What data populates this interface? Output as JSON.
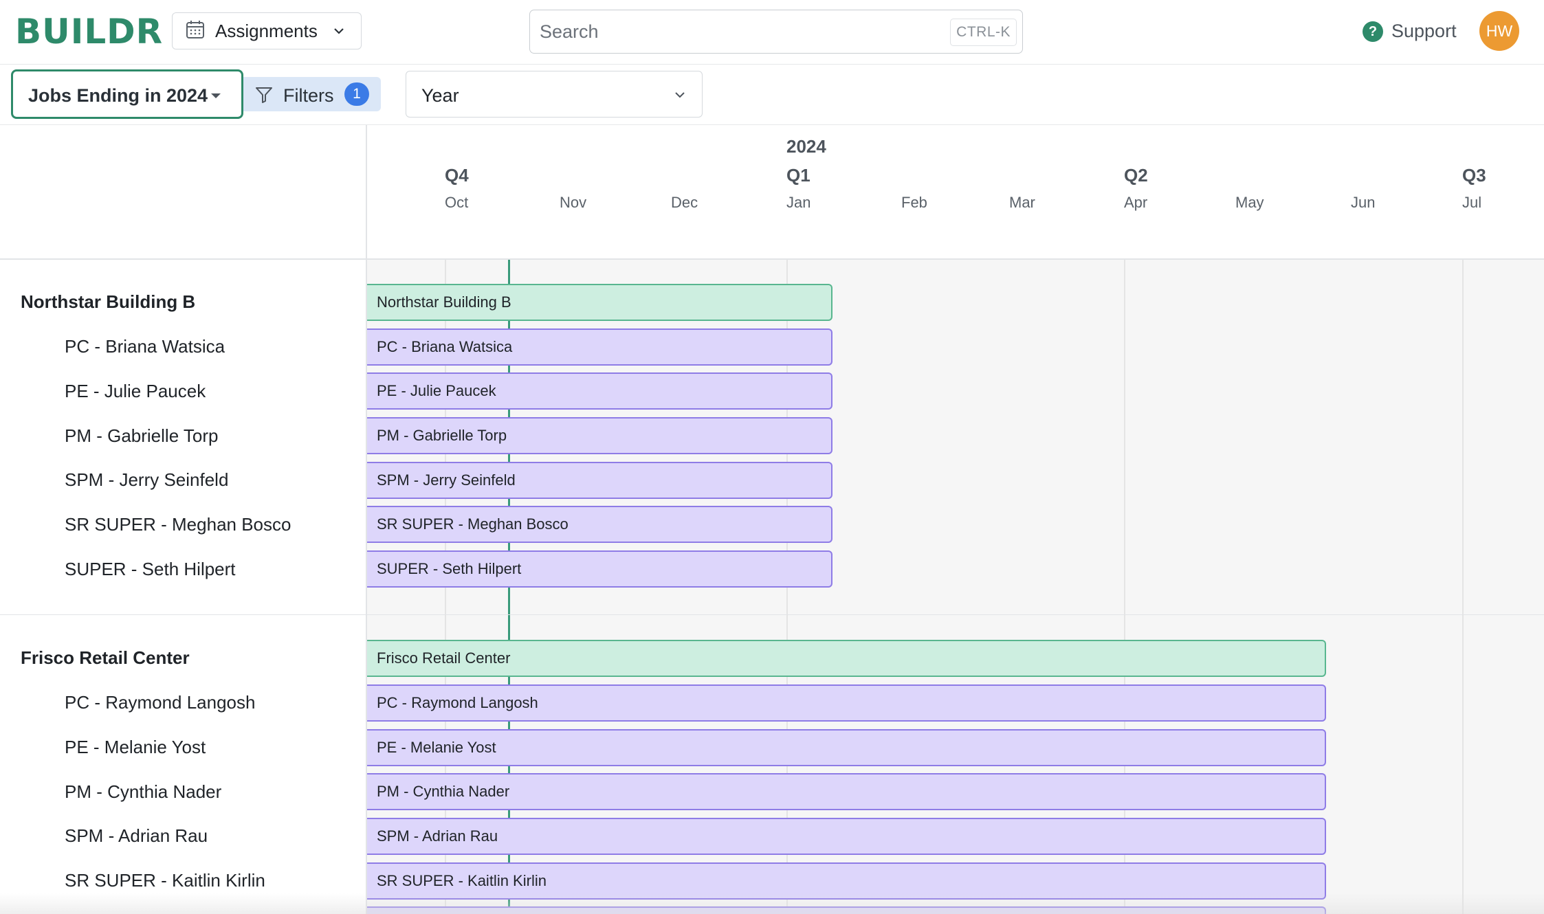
{
  "app": {
    "logo": "BUILDR"
  },
  "header": {
    "view_label": "Assignments",
    "search_placeholder": "Search",
    "search_shortcut": "CTRL-K",
    "support_label": "Support",
    "avatar_initials": "HW"
  },
  "toolbar": {
    "saved_view": "Jobs Ending in 2024",
    "filters_label": "Filters",
    "filters_count": "1",
    "range_label": "Year"
  },
  "timeline": {
    "year": "2024",
    "quarters": [
      "Q4",
      "Q1",
      "Q2",
      "Q3"
    ],
    "months": [
      "Oct",
      "Nov",
      "Dec",
      "Jan",
      "Feb",
      "Mar",
      "Apr",
      "May",
      "Jun",
      "Jul"
    ]
  },
  "groups": [
    {
      "title": "Northstar Building B",
      "rows": [
        "PC - Briana Watsica",
        "PE - Julie Paucek",
        "PM - Gabrielle Torp",
        "SPM - Jerry Seinfeld",
        "SR SUPER - Meghan Bosco",
        "SUPER - Seth Hilpert"
      ]
    },
    {
      "title": "Frisco Retail Center",
      "rows": [
        "PC - Raymond Langosh",
        "PE - Melanie Yost",
        "PM - Cynthia Nader",
        "SPM - Adrian Rau",
        "SR SUPER - Kaitlin Kirlin"
      ]
    }
  ],
  "colors": {
    "brand": "#2e8a6a",
    "job_bar": "#cdeee0",
    "person_bar": "#ddd6fb",
    "badge": "#3b7be6",
    "avatar": "#ec9a32"
  },
  "icons": {
    "view": "calendar-icon",
    "filters": "filter-icon",
    "support": "question-icon"
  }
}
